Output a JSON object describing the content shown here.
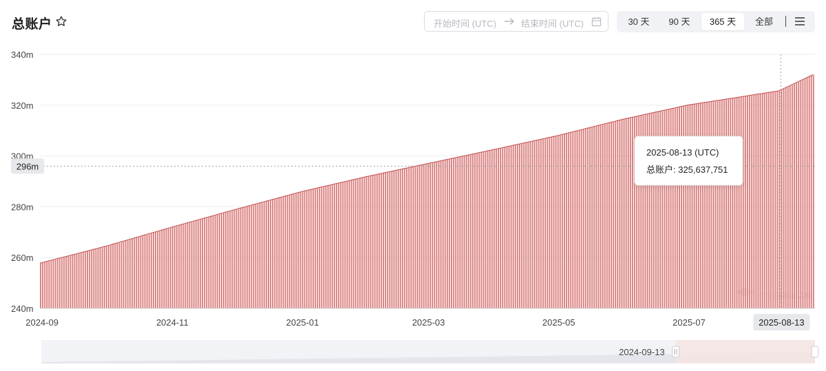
{
  "header": {
    "title": "总账户",
    "star_icon": "star-outline-icon",
    "date_start_placeholder": "开始时间 (UTC)",
    "date_end_placeholder": "结束时间 (UTC)",
    "arrow_icon": "arrow-right-icon",
    "calendar_icon": "calendar-icon",
    "range_buttons": [
      {
        "label": "30 天",
        "active": false
      },
      {
        "label": "90 天",
        "active": false
      },
      {
        "label": "365 天",
        "active": true
      },
      {
        "label": "全部",
        "active": false
      }
    ],
    "menu_icon": "menu-icon"
  },
  "colors": {
    "bar": "#d9807f",
    "bar_stroke": "#c24b4b",
    "grid": "#eeeeee",
    "crosshair_label_bg": "#e6e8eb",
    "slider_bg": "#f2f3f6",
    "slider_selected": "#f7e4e4"
  },
  "watermark": "TRONSCAN",
  "chart_data": {
    "type": "bar",
    "y_unit_suffix": "m",
    "ylim": [
      240,
      340
    ],
    "yticks": [
      "240m",
      "260m",
      "280m",
      "300m",
      "320m",
      "340m"
    ],
    "xticks": [
      "2024-09",
      "2024-11",
      "2025-01",
      "2025-03",
      "2025-05",
      "2025-07"
    ],
    "x_start": "2024-08-31",
    "x_end": "2025-08-29",
    "series": [
      {
        "points": [
          {
            "x": "2024-08-31",
            "y": 257.8
          },
          {
            "x": "2024-10-01",
            "y": 264.5
          },
          {
            "x": "2024-11-01",
            "y": 272.0
          },
          {
            "x": "2024-12-01",
            "y": 279.0
          },
          {
            "x": "2025-01-01",
            "y": 286.0
          },
          {
            "x": "2025-02-01",
            "y": 292.0
          },
          {
            "x": "2025-03-01",
            "y": 297.0
          },
          {
            "x": "2025-04-01",
            "y": 302.5
          },
          {
            "x": "2025-05-01",
            "y": 308.0
          },
          {
            "x": "2025-06-01",
            "y": 314.5
          },
          {
            "x": "2025-07-01",
            "y": 320.0
          },
          {
            "x": "2025-08-13",
            "y": 325.64
          },
          {
            "x": "2025-08-29",
            "y": 332.0
          }
        ]
      }
    ],
    "crosshair": {
      "y_label": "296m",
      "x_label": "2025-08-13",
      "x": "2025-08-13"
    },
    "tooltip": {
      "date": "2025-08-13 (UTC)",
      "label": "总账户",
      "separator": ":",
      "value": "325,637,751"
    },
    "slider": {
      "start_label": "2024-09-13",
      "start_fraction": 0.82
    }
  }
}
